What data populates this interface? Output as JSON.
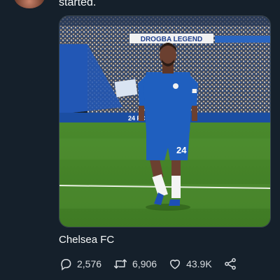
{
  "tweet": {
    "text": "started.",
    "media": {
      "banner_text": "DROGBA LEGEND",
      "scoreboard_text": "24 FC",
      "shorts_number": "24"
    },
    "caption": "Chelsea FC"
  },
  "actions": {
    "replies": "2,576",
    "reposts": "6,906",
    "likes": "43.9K"
  },
  "icons": {
    "reply": "reply-icon",
    "repost": "repost-icon",
    "like": "like-icon",
    "share": "share-icon"
  },
  "colors": {
    "background": "#15202b",
    "text": "#f7f9f9",
    "kit_blue": "#1f5fbf",
    "pitch_green": "#4f8a2e"
  }
}
